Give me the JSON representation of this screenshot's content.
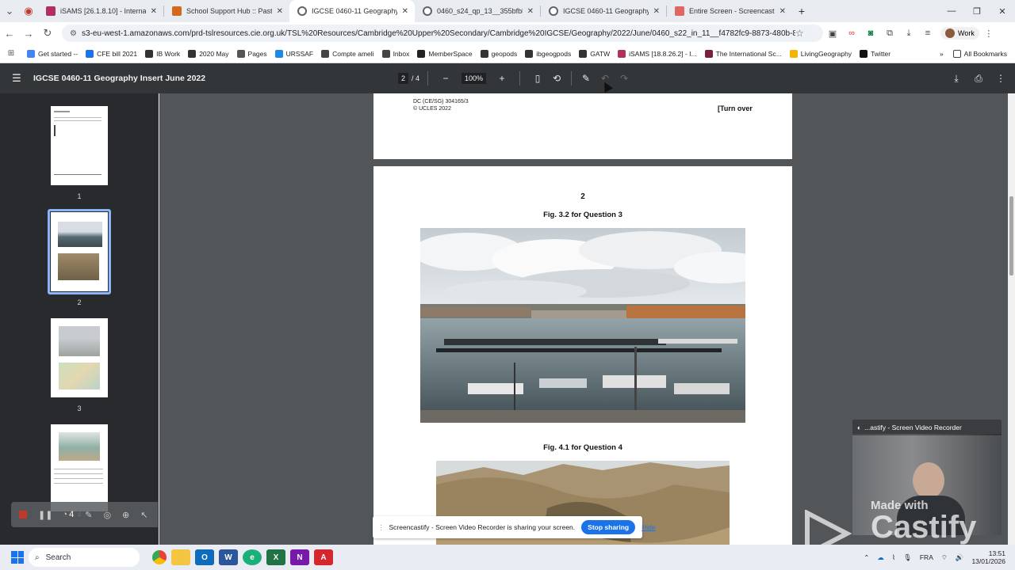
{
  "tabs": [
    {
      "title": "iSAMS [26.1.8.10] - Internation",
      "color": "#b03060",
      "active": false
    },
    {
      "title": "School Support Hub :: Past Exam",
      "color": "#d2691e",
      "active": false
    },
    {
      "title": "IGCSE 0460-11 Geography Inse",
      "color": "#5f6368",
      "active": true
    },
    {
      "title": "0460_s24_qp_13__355bfbbf-4f",
      "color": "#5f6368",
      "active": false
    },
    {
      "title": "IGCSE 0460-11 Geography June",
      "color": "#5f6368",
      "active": false
    },
    {
      "title": "Entire Screen - Screencastify -",
      "color": "#e06666",
      "active": false
    }
  ],
  "url": "s3-eu-west-1.amazonaws.com/prd-tslresources.cie.org.uk/TSL%20Resources/Cambridge%20Upper%20Secondary/Cambridge%20IGCSE/Geography/2022/June/0460_s22_in_11__f4782fc9-8873-480b-8a7c-288cfb8bd6d...",
  "profile": "Work",
  "bookmarks": [
    {
      "label": "Get started --",
      "color": "#4285f4"
    },
    {
      "label": "CFE bill 2021",
      "color": "#1a73e8"
    },
    {
      "label": "IB Work",
      "color": "#333333"
    },
    {
      "label": "2020 May",
      "color": "#333333"
    },
    {
      "label": "Pages",
      "color": "#555555"
    },
    {
      "label": "URSSAF",
      "color": "#1e88e5"
    },
    {
      "label": "Compte ameli",
      "color": "#444444"
    },
    {
      "label": "Inbox",
      "color": "#444444"
    },
    {
      "label": "MemberSpace",
      "color": "#222222"
    },
    {
      "label": "geopods",
      "color": "#333333"
    },
    {
      "label": "ibgeogpods",
      "color": "#333333"
    },
    {
      "label": "GATW",
      "color": "#333333"
    },
    {
      "label": "iSAMS [18.8.26.2] - I...",
      "color": "#b03060"
    },
    {
      "label": "The International Sc...",
      "color": "#7a1f3d"
    },
    {
      "label": "LivingGeography",
      "color": "#f4b400"
    },
    {
      "label": "Twitter",
      "color": "#111111"
    }
  ],
  "all_bookmarks": "All Bookmarks",
  "pdf": {
    "title": "IGCSE 0460-11 Geography Insert June 2022",
    "page": "2",
    "page_total": "/ 4",
    "zoom": "100%"
  },
  "thumbs": [
    "1",
    "2",
    "3",
    "4"
  ],
  "page1_footer": {
    "code": "DC (CE/SG) 304165/3",
    "copyright": "© UCLES 2022",
    "turn": "[Turn over"
  },
  "page2": {
    "number": "2",
    "fig1": "Fig. 3.2 for Question 3",
    "fig2": "Fig. 4.1 for Question 4"
  },
  "share_bar": {
    "text": "Screencastify - Screen Video Recorder is sharing your screen.",
    "stop": "Stop sharing",
    "hide": "Hide"
  },
  "recorder": {
    "title": "...astify - Screen Video Recorder",
    "made_with": "Made with",
    "brand": "Castify"
  },
  "toolbar_count": "4",
  "taskbar": {
    "search": "Search",
    "lang": "FRA",
    "time": "13:51",
    "date": "13/01/2026"
  }
}
